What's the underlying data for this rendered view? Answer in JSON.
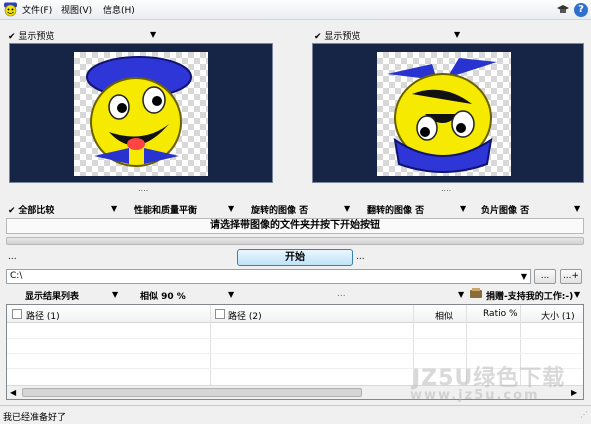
{
  "menu": {
    "file": "文件(F)",
    "view": "视图(V)",
    "info": "信息(H)"
  },
  "toolbar": {
    "app_icon": "smiley-icon",
    "settings_icon": "mortarboard-icon",
    "help_icon": "help-icon",
    "help_glyph": "?"
  },
  "preview": {
    "left_label": "显示预览",
    "right_label": "显示预览",
    "left_image": "smiley-with-hat-image",
    "right_image": "rotated-smiley-image",
    "splitter": "...."
  },
  "options": {
    "compare_all": "全部比较",
    "performance": "性能和质量平衡",
    "rotated": "旋转的图像 否",
    "flipped": "翻转的图像 否",
    "negative": "负片图像 否"
  },
  "instruction": "请选择带图像的文件夹并按下开始按钮",
  "start": {
    "label": "开始",
    "left_dots": "...",
    "right_dots": "..."
  },
  "path": {
    "value": "C:\\",
    "browse_label": "...",
    "add_label": "...+"
  },
  "results": {
    "show_list": "显示结果列表",
    "similarity": "相似 90 %",
    "more": "...",
    "donate": "捐赠-支持我的工作:-)"
  },
  "table": {
    "headers": [
      "路径 (1)",
      "路径 (2)",
      "相似",
      "Ratio %",
      "大小 (1)"
    ]
  },
  "status": {
    "text": "我已经准备好了"
  },
  "watermark": {
    "main": "JZ5U绿色下载",
    "url": "www.jz5u.com"
  },
  "colors": {
    "preview_bg": "#162546",
    "accent": "#3c7fb1"
  }
}
